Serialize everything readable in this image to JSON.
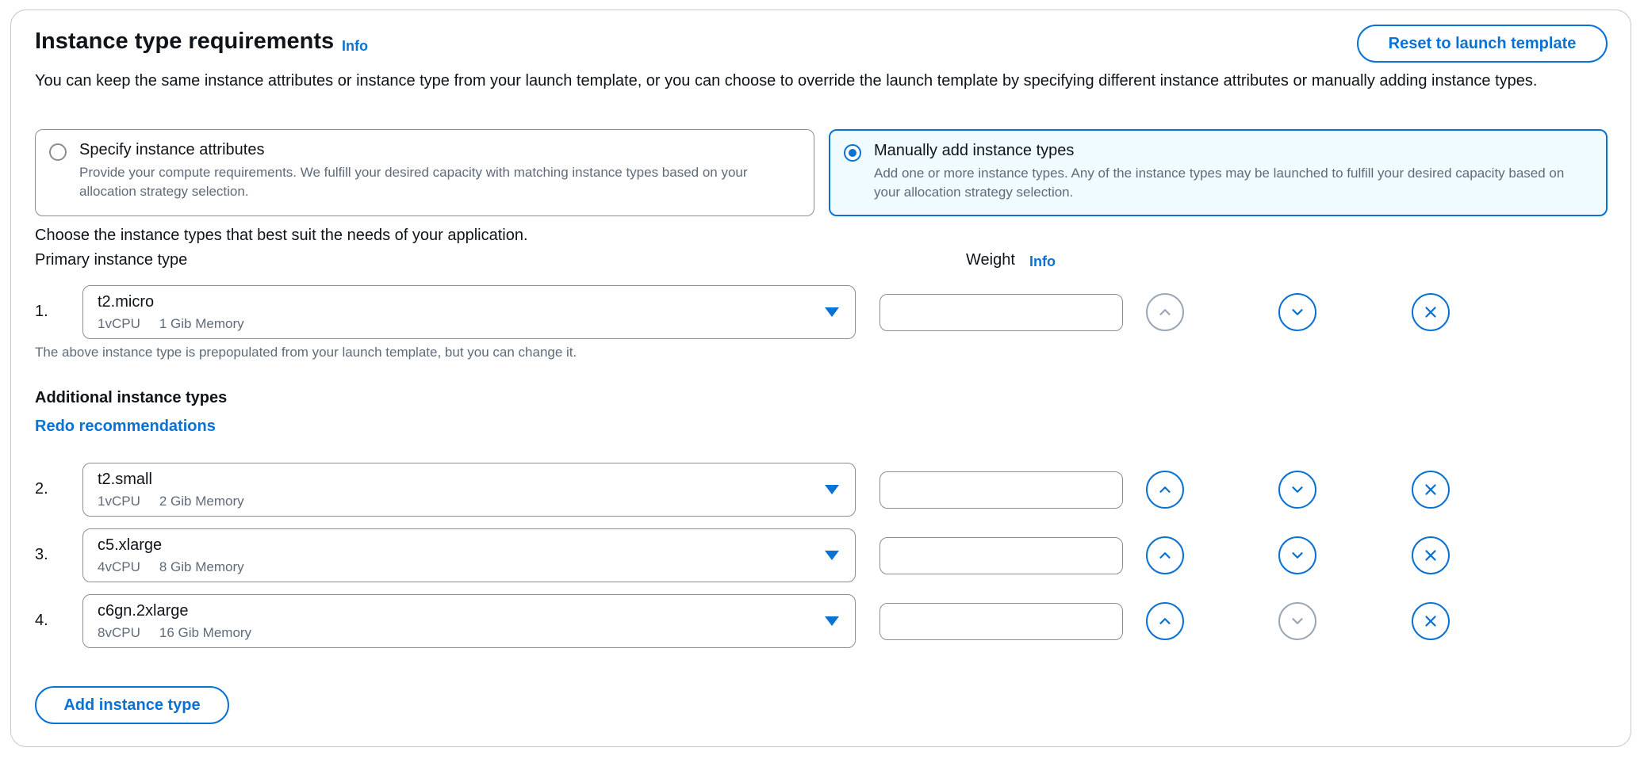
{
  "header": {
    "title": "Instance type requirements",
    "info_label": "Info",
    "reset_button": "Reset to launch template",
    "description": "You can keep the same instance attributes or instance type from your launch template, or you can choose to override the launch template by specifying different instance attributes or manually adding instance types."
  },
  "options": [
    {
      "label": "Specify instance attributes",
      "description": "Provide your compute requirements. We fulfill your desired capacity with matching instance types based on your allocation strategy selection.",
      "selected": false
    },
    {
      "label": "Manually add instance types",
      "description": "Add one or more instance types. Any of the instance types may be launched to fulfill your desired capacity based on your allocation strategy selection.",
      "selected": true
    }
  ],
  "choose_text": "Choose the instance types that best suit the needs of your application.",
  "primary": {
    "label": "Primary instance type",
    "weight_label": "Weight",
    "weight_info": "Info",
    "help": "The above instance type is prepopulated from your launch template, but you can change it."
  },
  "additional": {
    "heading": "Additional instance types",
    "redo_link": "Redo recommendations"
  },
  "rows": [
    {
      "num": "1.",
      "name": "t2.micro",
      "vcpu": "1vCPU",
      "memory": "1 Gib Memory",
      "weight": "",
      "up_disabled": true,
      "down_disabled": false
    },
    {
      "num": "2.",
      "name": "t2.small",
      "vcpu": "1vCPU",
      "memory": "2 Gib Memory",
      "weight": "",
      "up_disabled": false,
      "down_disabled": false
    },
    {
      "num": "3.",
      "name": "c5.xlarge",
      "vcpu": "4vCPU",
      "memory": "8 Gib Memory",
      "weight": "",
      "up_disabled": false,
      "down_disabled": false
    },
    {
      "num": "4.",
      "name": "c6gn.2xlarge",
      "vcpu": "8vCPU",
      "memory": "16 Gib Memory",
      "weight": "",
      "up_disabled": false,
      "down_disabled": true
    }
  ],
  "add_button": "Add instance type",
  "colors": {
    "accent": "#0972d3",
    "disabled": "#9ba7b6",
    "selected_tile_bg": "#f0fbff",
    "border": "#8c8c94",
    "muted_text": "#5f6b7a"
  },
  "icons": {
    "move_up": "chevron-up-icon",
    "move_down": "chevron-down-icon",
    "remove": "close-icon",
    "dropdown": "caret-down-icon"
  }
}
